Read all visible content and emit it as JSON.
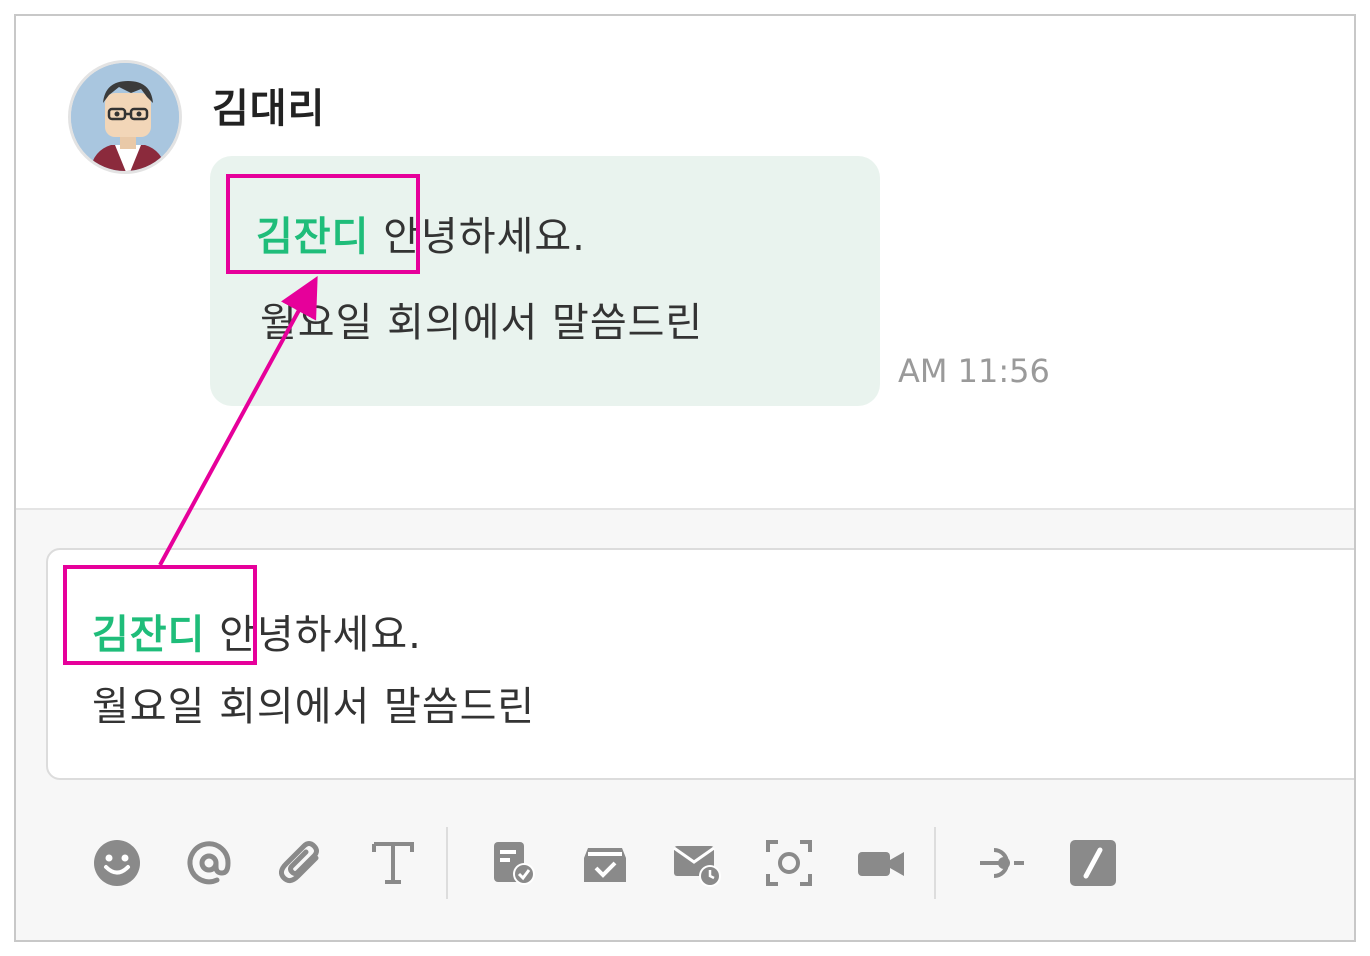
{
  "chat": {
    "sender_name": "김대리",
    "message": {
      "mention": "김잔디",
      "line1_rest": " 안녕하세요.",
      "line2": "월요일 회의에서 말씀드린",
      "time": "AM 11:56"
    }
  },
  "composer": {
    "mention": "김잔디",
    "line1_rest": " 안녕하세요.",
    "line2": "월요일 회의에서 말씀드린"
  },
  "toolbar": {
    "icons": [
      "emoji-icon",
      "mention-icon",
      "attach-icon",
      "text-format-icon",
      "file-check-icon",
      "archive-check-icon",
      "scheduled-mail-icon",
      "screenshot-icon",
      "video-icon",
      "connect-icon",
      "slash-command-icon"
    ]
  },
  "colors": {
    "mention": "#1fbd7a",
    "annotation": "#e6009a",
    "bubble_bg": "#e9f3ee",
    "icon": "#8a8a8a"
  }
}
